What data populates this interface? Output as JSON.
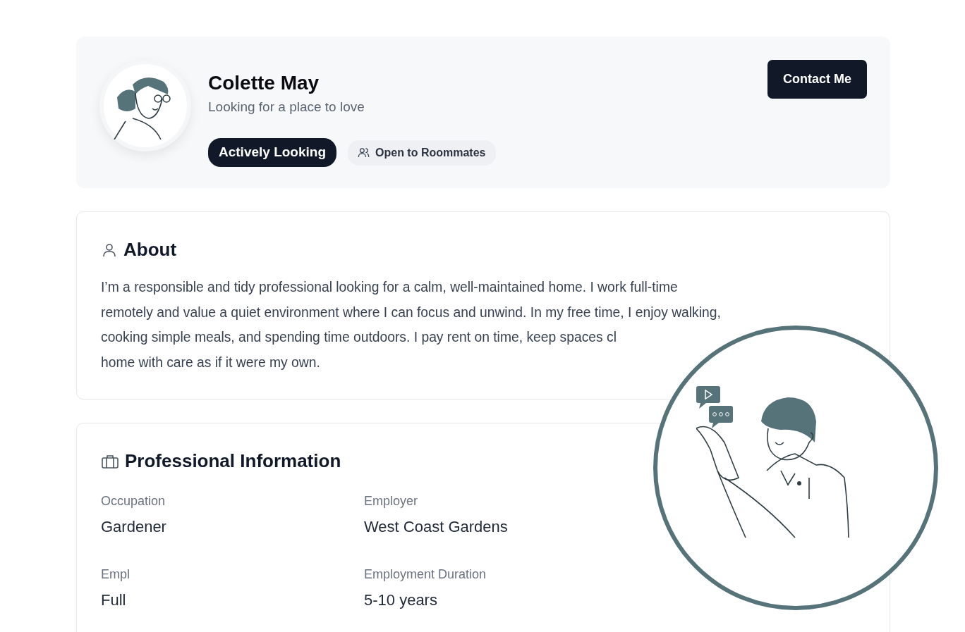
{
  "profile": {
    "name": "Colette May",
    "tagline": "Looking for a place to love",
    "contact_button": "Contact Me",
    "badges": [
      {
        "label": "Actively Looking",
        "kind": "primary"
      },
      {
        "label": "Open to Roommates",
        "kind": "secondary"
      }
    ]
  },
  "about": {
    "title": "About",
    "lines": [
      "I’m a responsible and tidy professional looking for a calm, well-maintained home. I work full-time",
      "remotely and value a quiet environment where I can focus and unwind. In my free time, I enjoy walking,",
      "cooking simple meals, and spending time outdoors. I pay rent on time, keep spaces cl",
      "home with care as if it were my own."
    ]
  },
  "professional": {
    "title": "Professional Information",
    "fields": [
      {
        "label": "Occupation",
        "value": "Gardener"
      },
      {
        "label": "Employer",
        "value": "West Coast Gardens"
      },
      {
        "label": "Empl",
        "value": "Full"
      },
      {
        "label": "Employment Duration",
        "value": "5-10 years"
      }
    ]
  }
}
